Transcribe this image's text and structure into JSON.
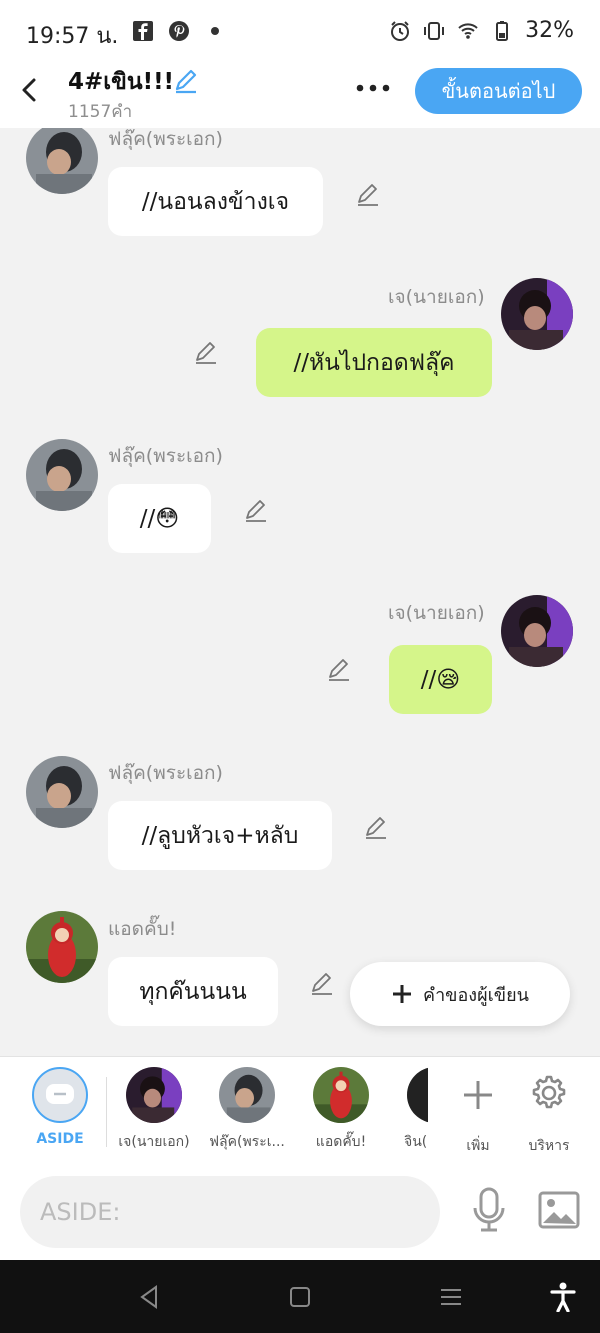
{
  "status": {
    "time": "19:57 น.",
    "battery": "32%"
  },
  "header": {
    "title": "4#เขิน!!!",
    "word_count": "1157คำ",
    "next_label": "ขั้นตอนต่อไป"
  },
  "messages": [
    {
      "speaker": "ฟลุ๊ค(พระเอก)",
      "text": "//นอนลงข้างเจ",
      "side": "left"
    },
    {
      "speaker": "เจ(นายเอก)",
      "text": "//หันไปกอดฟลุ๊ค",
      "side": "right"
    },
    {
      "speaker": "ฟลุ๊ค(พระเอก)",
      "text": "//😳",
      "side": "left"
    },
    {
      "speaker": "เจ(นายเอก)",
      "text": "//😪",
      "side": "right"
    },
    {
      "speaker": "ฟลุ๊ค(พระเอก)",
      "text": "//ลูบหัวเจ+หลับ",
      "side": "left"
    },
    {
      "speaker": "แอดคั๊บ!",
      "text": "ทุกค๊นนนน",
      "side": "left"
    }
  ],
  "fab": {
    "label": "คำของผู้เขียน"
  },
  "characters": {
    "aside": "ASIDE",
    "items": [
      "เจ(นายเอก)",
      "ฟลุ๊ค(พระเ...",
      "แอดคั๊บ!",
      "จิน("
    ],
    "add": "เพิ่ม",
    "manage": "บริหาร"
  },
  "input": {
    "placeholder": "ASIDE:"
  },
  "colors": {
    "accent": "#4aa6f3",
    "right_bubble": "#d5f58a",
    "left_bubble": "#ffffff"
  }
}
